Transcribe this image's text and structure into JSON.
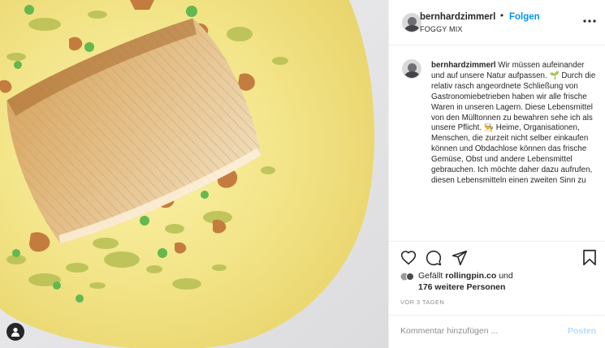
{
  "post": {
    "username": "bernhardzimmerl",
    "separator": "•",
    "follow_label": "Folgen",
    "location": "FOGGY MIX",
    "caption_user": "bernhardzimmerl",
    "caption_p1": "Wir müssen aufeinander und auf unsere Natur aufpassen.",
    "emoji1": "🌱",
    "caption_p2": "Durch die relativ rasch angeordnete Schließung von Gastronomiebetrieben haben wir alle frische Waren in unseren Lagern. Diese Lebensmittel von den Mülltonnen zu bewahren sehe ich als unsere Pflicht.",
    "emoji2": "👨‍🍳",
    "caption_p3": "Heime, Organisationen, Menschen, die zurzeit nicht selber einkaufen können und Obdachlose können das frische Gemüse, Obst und andere Lebensmittel gebrauchen. Ich möchte daher dazu aufrufen, diesen Lebensmitteln einen zweiten Sinn zu"
  },
  "engagement": {
    "liked_prefix": "Gefällt ",
    "liked_by": "rollingpin.co",
    "liked_and": "und",
    "others": "176 weitere Personen",
    "date": "VOR 3 TAGEN"
  },
  "comment": {
    "placeholder": "Kommentar hinzufügen ...",
    "post_label": "Posten"
  },
  "icons": {
    "like": "heart-icon",
    "comment": "comment-icon",
    "share": "share-icon",
    "save": "bookmark-icon",
    "more": "more-options-icon",
    "tags": "user-tag-icon"
  },
  "colors": {
    "accent": "#0095f6",
    "post_disabled": "#b3dbff",
    "sauce": "#f2e28a"
  }
}
